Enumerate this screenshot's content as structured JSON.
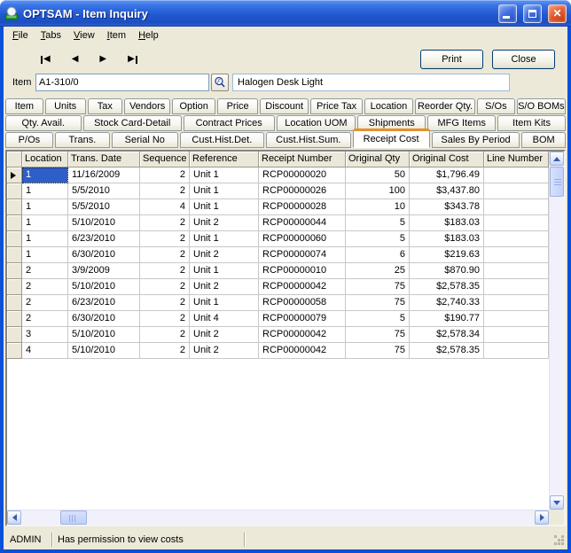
{
  "window": {
    "title": "OPTSAM - Item Inquiry",
    "icons": {
      "app": "app-icon",
      "minimize": "minimize-icon",
      "maximize": "maximize-icon",
      "close": "close-icon"
    }
  },
  "menu": {
    "items": [
      {
        "label": "File"
      },
      {
        "label": "Tabs"
      },
      {
        "label": "View"
      },
      {
        "label": "Item"
      },
      {
        "label": "Help"
      }
    ]
  },
  "toolbar": {
    "nav_icons": [
      "first-record-icon",
      "previous-record-icon",
      "next-record-icon",
      "last-record-icon"
    ],
    "print_label": "Print",
    "close_label": "Close"
  },
  "item_bar": {
    "label": "Item",
    "value": "A1-310/0",
    "finder_icon": "magnifier-find-icon",
    "description": "Halogen Desk Light"
  },
  "tabs": {
    "active": "Receipt Cost",
    "rows": [
      [
        "Item",
        "Units",
        "Tax",
        "Vendors",
        "Option",
        "Price",
        "Discount",
        "Price Tax",
        "Location",
        "Reorder Qty.",
        "S/Os",
        "S/O BOMs"
      ],
      [
        "Qty. Avail.",
        "Stock Card-Detail",
        "Contract Prices",
        "Location UOM",
        "Shipments",
        "MFG Items",
        "Item Kits"
      ],
      [
        "P/Os",
        "Trans.",
        "Serial No",
        "Cust.Hist.Det.",
        "Cust.Hist.Sum.",
        "Receipt Cost",
        "Sales By Period",
        "BOM"
      ]
    ]
  },
  "grid": {
    "columns": [
      "Location",
      "Trans. Date",
      "Sequence",
      "Reference",
      "Receipt Number",
      "Original Qty",
      "Original Cost",
      "Line Number"
    ],
    "column_aligns": [
      "left",
      "left",
      "right",
      "left",
      "left",
      "right",
      "right",
      "left"
    ],
    "selected": {
      "row": 0,
      "column": "Location"
    },
    "rows": [
      [
        "1",
        "11/16/2009",
        "2",
        "Unit 1",
        "RCP00000020",
        "50",
        "$1,796.49",
        ""
      ],
      [
        "1",
        "5/5/2010",
        "2",
        "Unit 1",
        "RCP00000026",
        "100",
        "$3,437.80",
        ""
      ],
      [
        "1",
        "5/5/2010",
        "4",
        "Unit 1",
        "RCP00000028",
        "10",
        "$343.78",
        ""
      ],
      [
        "1",
        "5/10/2010",
        "2",
        "Unit 2",
        "RCP00000044",
        "5",
        "$183.03",
        ""
      ],
      [
        "1",
        "6/23/2010",
        "2",
        "Unit 1",
        "RCP00000060",
        "5",
        "$183.03",
        ""
      ],
      [
        "1",
        "6/30/2010",
        "2",
        "Unit 2",
        "RCP00000074",
        "6",
        "$219.63",
        ""
      ],
      [
        "2",
        "3/9/2009",
        "2",
        "Unit 1",
        "RCP00000010",
        "25",
        "$870.90",
        ""
      ],
      [
        "2",
        "5/10/2010",
        "2",
        "Unit 2",
        "RCP00000042",
        "75",
        "$2,578.35",
        ""
      ],
      [
        "2",
        "6/23/2010",
        "2",
        "Unit 1",
        "RCP00000058",
        "75",
        "$2,740.33",
        ""
      ],
      [
        "2",
        "6/30/2010",
        "2",
        "Unit 4",
        "RCP00000079",
        "5",
        "$190.77",
        ""
      ],
      [
        "3",
        "5/10/2010",
        "2",
        "Unit 2",
        "RCP00000042",
        "75",
        "$2,578.34",
        ""
      ],
      [
        "4",
        "5/10/2010",
        "2",
        "Unit 2",
        "RCP00000042",
        "75",
        "$2,578.35",
        ""
      ]
    ]
  },
  "status_bar": {
    "user": "ADMIN",
    "message": "Has permission to view costs"
  },
  "colors": {
    "titlebar_blue": "#2159d2",
    "window_border": "#0b50d8",
    "face": "#ece9d8",
    "selection_blue": "#2e5ec8",
    "active_tab_accent": "#e5902e"
  }
}
